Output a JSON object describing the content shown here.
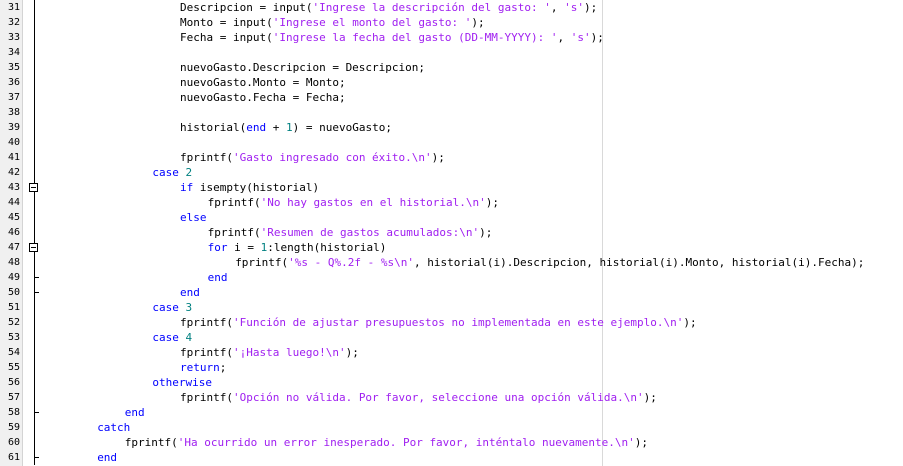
{
  "editor": {
    "colors": {
      "keyword": "#0000ff",
      "string": "#a020f0",
      "number": "#008080",
      "text": "#000000",
      "gutter_bg": "#f0f0f0"
    },
    "lines": [
      {
        "n": "31",
        "fold": "v",
        "segs": [
          {
            "t": "",
            "c": "p",
            "x": ""
          },
          {
            "t": "Descripcion = input(",
            "c": "p"
          },
          {
            "t": "'Ingrese la descripción del gasto: '",
            "c": "s"
          },
          {
            "t": ", ",
            "c": "p"
          },
          {
            "t": "'s'",
            "c": "s"
          },
          {
            "t": ");",
            "c": "p"
          }
        ],
        "indent": 20
      },
      {
        "n": "32",
        "fold": "v",
        "segs": [
          {
            "t": "Monto = input(",
            "c": "p"
          },
          {
            "t": "'Ingrese el monto del gasto: '",
            "c": "s"
          },
          {
            "t": ");",
            "c": "p"
          }
        ],
        "indent": 20
      },
      {
        "n": "33",
        "fold": "v",
        "segs": [
          {
            "t": "Fecha = input(",
            "c": "p"
          },
          {
            "t": "'Ingrese la fecha del gasto (DD-MM-YYYY): '",
            "c": "s"
          },
          {
            "t": ", ",
            "c": "p"
          },
          {
            "t": "'s'",
            "c": "s"
          },
          {
            "t": ");",
            "c": "p"
          }
        ],
        "indent": 20
      },
      {
        "n": "34",
        "fold": "v",
        "segs": [],
        "indent": 0
      },
      {
        "n": "35",
        "fold": "v",
        "segs": [
          {
            "t": "nuevoGasto.Descripcion = Descripcion;",
            "c": "p"
          }
        ],
        "indent": 20
      },
      {
        "n": "36",
        "fold": "v",
        "segs": [
          {
            "t": "nuevoGasto.Monto = Monto;",
            "c": "p"
          }
        ],
        "indent": 20
      },
      {
        "n": "37",
        "fold": "v",
        "segs": [
          {
            "t": "nuevoGasto.Fecha = Fecha;",
            "c": "p"
          }
        ],
        "indent": 20
      },
      {
        "n": "38",
        "fold": "v",
        "segs": [],
        "indent": 0
      },
      {
        "n": "39",
        "fold": "v",
        "segs": [
          {
            "t": "historial(",
            "c": "p"
          },
          {
            "t": "end",
            "c": "k"
          },
          {
            "t": " + ",
            "c": "p"
          },
          {
            "t": "1",
            "c": "n"
          },
          {
            "t": ") = nuevoGasto;",
            "c": "p"
          }
        ],
        "indent": 20
      },
      {
        "n": "40",
        "fold": "v",
        "segs": [],
        "indent": 0
      },
      {
        "n": "41",
        "fold": "v",
        "segs": [
          {
            "t": "fprintf(",
            "c": "p"
          },
          {
            "t": "'Gasto ingresado con éxito.\\n'",
            "c": "s"
          },
          {
            "t": ");",
            "c": "p"
          }
        ],
        "indent": 20
      },
      {
        "n": "42",
        "fold": "v",
        "segs": [
          {
            "t": "case ",
            "c": "k"
          },
          {
            "t": "2",
            "c": "n"
          }
        ],
        "indent": 16
      },
      {
        "n": "43",
        "fold": "box",
        "segs": [
          {
            "t": "if ",
            "c": "k"
          },
          {
            "t": "isempty(historial)",
            "c": "p"
          }
        ],
        "indent": 20
      },
      {
        "n": "44",
        "fold": "v",
        "segs": [
          {
            "t": "fprintf(",
            "c": "p"
          },
          {
            "t": "'No hay gastos en el historial.\\n'",
            "c": "s"
          },
          {
            "t": ");",
            "c": "p"
          }
        ],
        "indent": 24
      },
      {
        "n": "45",
        "fold": "v",
        "segs": [
          {
            "t": "else",
            "c": "k"
          }
        ],
        "indent": 20
      },
      {
        "n": "46",
        "fold": "v",
        "segs": [
          {
            "t": "fprintf(",
            "c": "p"
          },
          {
            "t": "'Resumen de gastos acumulados:\\n'",
            "c": "s"
          },
          {
            "t": ");",
            "c": "p"
          }
        ],
        "indent": 24
      },
      {
        "n": "47",
        "fold": "box",
        "segs": [
          {
            "t": "for ",
            "c": "k"
          },
          {
            "t": "i = ",
            "c": "p"
          },
          {
            "t": "1",
            "c": "n"
          },
          {
            "t": ":length(historial)",
            "c": "p"
          }
        ],
        "indent": 24
      },
      {
        "n": "48",
        "fold": "v",
        "segs": [
          {
            "t": "fprintf(",
            "c": "p"
          },
          {
            "t": "'%s - Q%.2f - %s\\n'",
            "c": "s"
          },
          {
            "t": ", historial(i).Descripcion, historial(i).Monto, historial(i).Fecha);",
            "c": "p"
          }
        ],
        "indent": 28
      },
      {
        "n": "49",
        "fold": "end",
        "segs": [
          {
            "t": "end",
            "c": "k"
          }
        ],
        "indent": 24
      },
      {
        "n": "50",
        "fold": "end",
        "segs": [
          {
            "t": "end",
            "c": "k"
          }
        ],
        "indent": 20
      },
      {
        "n": "51",
        "fold": "v",
        "segs": [
          {
            "t": "case ",
            "c": "k"
          },
          {
            "t": "3",
            "c": "n"
          }
        ],
        "indent": 16
      },
      {
        "n": "52",
        "fold": "v",
        "segs": [
          {
            "t": "fprintf(",
            "c": "p"
          },
          {
            "t": "'Función de ajustar presupuestos no implementada en este ejemplo.\\n'",
            "c": "s"
          },
          {
            "t": ");",
            "c": "p"
          }
        ],
        "indent": 20
      },
      {
        "n": "53",
        "fold": "v",
        "segs": [
          {
            "t": "case ",
            "c": "k"
          },
          {
            "t": "4",
            "c": "n"
          }
        ],
        "indent": 16
      },
      {
        "n": "54",
        "fold": "v",
        "segs": [
          {
            "t": "fprintf(",
            "c": "p"
          },
          {
            "t": "'¡Hasta luego!\\n'",
            "c": "s"
          },
          {
            "t": ");",
            "c": "p"
          }
        ],
        "indent": 20
      },
      {
        "n": "55",
        "fold": "v",
        "segs": [
          {
            "t": "return",
            "c": "k"
          },
          {
            "t": ";",
            "c": "p"
          }
        ],
        "indent": 20
      },
      {
        "n": "56",
        "fold": "v",
        "segs": [
          {
            "t": "otherwise",
            "c": "k"
          }
        ],
        "indent": 16
      },
      {
        "n": "57",
        "fold": "v",
        "segs": [
          {
            "t": "fprintf(",
            "c": "p"
          },
          {
            "t": "'Opción no válida. Por favor, seleccione una opción válida.\\n'",
            "c": "s"
          },
          {
            "t": ");",
            "c": "p"
          }
        ],
        "indent": 20
      },
      {
        "n": "58",
        "fold": "end",
        "segs": [
          {
            "t": "end",
            "c": "k"
          }
        ],
        "indent": 12
      },
      {
        "n": "59",
        "fold": "v",
        "segs": [
          {
            "t": "catch",
            "c": "k"
          }
        ],
        "indent": 8
      },
      {
        "n": "60",
        "fold": "v",
        "segs": [
          {
            "t": "fprintf(",
            "c": "p"
          },
          {
            "t": "'Ha ocurrido un error inesperado. Por favor, inténtalo nuevamente.\\n'",
            "c": "s"
          },
          {
            "t": ");",
            "c": "p"
          }
        ],
        "indent": 12
      },
      {
        "n": "61",
        "fold": "end",
        "segs": [
          {
            "t": "end",
            "c": "k"
          }
        ],
        "indent": 8
      }
    ]
  }
}
